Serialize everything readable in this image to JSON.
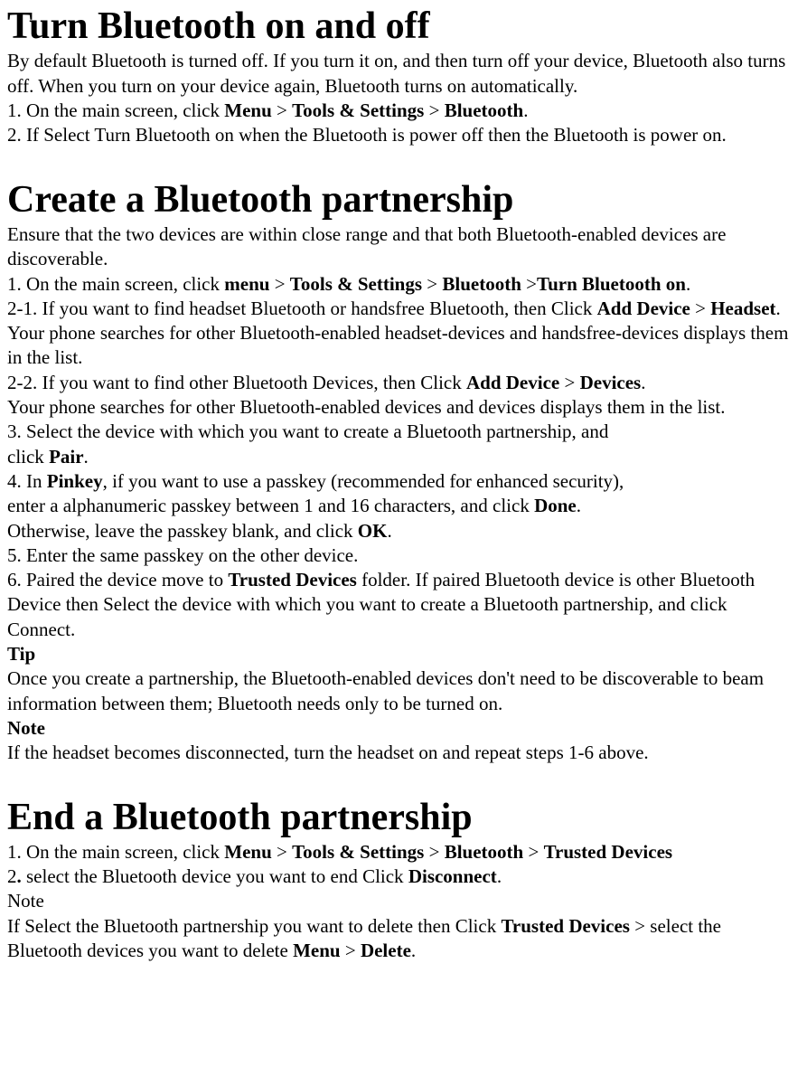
{
  "section1": {
    "heading": "Turn Bluetooth on and off",
    "intro": "By default Bluetooth is turned off. If you turn it on, and then turn off your device, Bluetooth also turns off. When you turn on your device again, Bluetooth turns on automatically.",
    "step1_prefix": "1. On the main screen, click ",
    "menu": "Menu",
    "gt": " > ",
    "tools": "Tools & Settings",
    "bluetooth": "Bluetooth",
    "period": ".",
    "step2": "2. If Select Turn Bluetooth on when the Bluetooth is power off then the Bluetooth is power on."
  },
  "section2": {
    "heading": "Create a Bluetooth partnership",
    "intro": "Ensure that the two devices are within close range and that both Bluetooth-enabled devices are discoverable.",
    "s1_prefix": "1. On the main screen, click ",
    "menu": "menu",
    "gt": " > ",
    "tools": "Tools & Settings",
    "bluetooth": "Bluetooth",
    "gt2": " >",
    "turn_on": "Turn Bluetooth on",
    "period": ".",
    "s2_1a": "2-1. If you want to find headset Bluetooth or handsfree Bluetooth, then Click ",
    "add_device": "Add Device",
    "headset": "Headset",
    "s2_1b": ". Your phone searches for other Bluetooth-enabled headset-devices and handsfree-devices displays them in the list.",
    "s2_2a": "2-2. If you want to find other Bluetooth Devices, then Click ",
    "devices": "Devices",
    "s2_2b": "Your phone searches for other Bluetooth-enabled devices and devices displays them in the list.",
    "s3a": "3. Select the device with which you want to create a Bluetooth partnership, and",
    "s3b": "click ",
    "pair": "Pair",
    "s4a": "4. In ",
    "pinkey": "Pinkey",
    "s4b": ", if you want to use a passkey (recommended for enhanced security),",
    "s4c": "enter a alphanumeric passkey between 1 and 16 characters, and click ",
    "done": "Done",
    "s4d": "Otherwise, leave the passkey blank, and click ",
    "ok": "OK",
    "s5": "5. Enter the same passkey on the other device.",
    "s6a": "6. Paired the device move to ",
    "trusted": "Trusted Devices",
    "s6b": " folder. If paired Bluetooth device is other Bluetooth Device then Select the device with which you want to create a Bluetooth partnership, and click Connect.",
    "tip_label": "Tip",
    "tip_text": "Once you create a partnership, the Bluetooth-enabled devices don't need to be discoverable to beam information between them; Bluetooth needs only to be turned on.",
    "note_label": "Note",
    "note_text": "If the headset becomes disconnected, turn the headset on and repeat steps 1-6 above."
  },
  "section3": {
    "heading": "End a Bluetooth partnership",
    "s1_prefix": "1. On the main screen, click ",
    "menu": "Menu",
    "gt": " > ",
    "tools": "Tools & Settings",
    "bluetooth": "Bluetooth",
    "trusted": "Trusted Devices",
    "s2a": "2",
    "s2dot": ".",
    "s2b": " select the Bluetooth device you want to end Click ",
    "disconnect": "Disconnect",
    "period": ".",
    "note_label": "Note",
    "note_a": "If Select the Bluetooth partnership you want to delete then Click ",
    "note_b": " > select the Bluetooth devices you want to delete ",
    "delete": "Delete"
  }
}
